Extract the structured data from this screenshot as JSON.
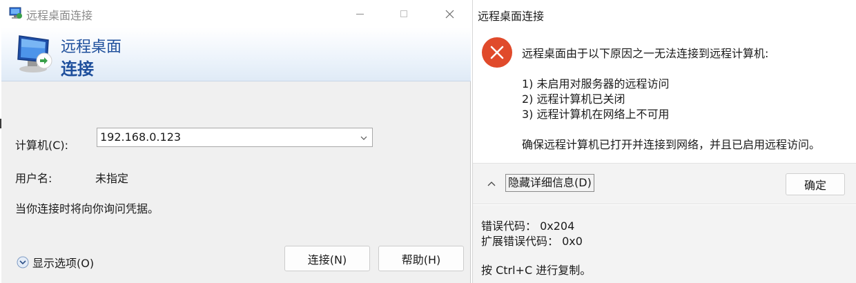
{
  "rdc_window": {
    "title": "远程桌面连接",
    "banner": {
      "line1": "远程桌面",
      "line2": "连接"
    },
    "computer": {
      "label": "计算机(C):",
      "value": "192.168.0.123"
    },
    "username": {
      "label": "用户名:",
      "value": "未指定"
    },
    "hint": "当你连接时将向你询问凭据。",
    "show_options_label": "显示选项(O)",
    "buttons": {
      "connect": "连接(N)",
      "help": "帮助(H)"
    },
    "icons": [
      "remote-desktop-icon",
      "minimize-icon",
      "maximize-icon",
      "close-icon",
      "chevron-down-icon",
      "expand-options-icon"
    ]
  },
  "error_dialog": {
    "title": "远程桌面连接",
    "message_main": "远程桌面由于以下原因之一无法连接到远程计算机:",
    "reasons": [
      "1) 未启用对服务器的远程访问",
      "2) 远程计算机已关闭",
      "3) 远程计算机在网络上不可用"
    ],
    "ensure_text": "确保远程计算机已打开并连接到网络，并且已启用远程访问。",
    "hide_details_label": "隐藏详细信息(D)",
    "ok_label": "确定",
    "details": {
      "error_code": "错误代码： 0x204",
      "extended_error_code": "扩展错误代码： 0x0",
      "copy_hint": "按 Ctrl+C 进行复制。"
    },
    "icons": [
      "error-icon",
      "chevron-up-icon"
    ],
    "colors": {
      "error_red": "#e04a2b"
    }
  }
}
